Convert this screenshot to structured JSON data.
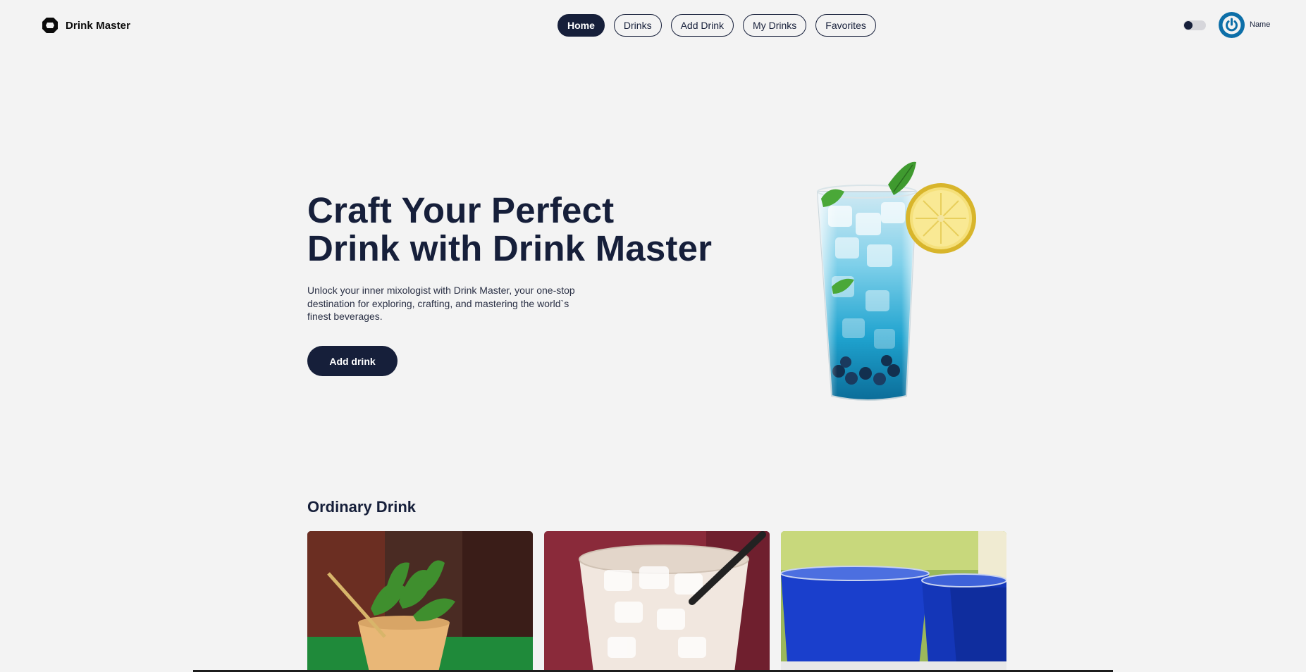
{
  "header": {
    "app_name": "Drink Master",
    "logo_icon": "octagon-logo-icon",
    "nav": [
      {
        "label": "Home",
        "active": true
      },
      {
        "label": "Drinks",
        "active": false
      },
      {
        "label": "Add Drink",
        "active": false
      },
      {
        "label": "My Drinks",
        "active": false
      },
      {
        "label": "Favorites",
        "active": false
      }
    ],
    "theme_toggle": {
      "icon": "theme-toggle-icon"
    },
    "user": {
      "name": "Name",
      "avatar_icon": "power-icon"
    }
  },
  "hero": {
    "title_line1": "Craft Your Perfect",
    "title_line2": "Drink with Drink Master",
    "description": "Unlock your inner mixologist with Drink Master, your one-stop destination for exploring, crafting, and mastering the world`s finest beverages.",
    "cta_label": "Add drink",
    "image_icon": "blue-cocktail-image"
  },
  "section": {
    "title": "Ordinary Drink",
    "cards": [
      {
        "image_icon": "mint-julep-image"
      },
      {
        "image_icon": "white-russian-image"
      },
      {
        "image_icon": "blue-drinks-image"
      }
    ]
  },
  "colors": {
    "primary": "#161f3a",
    "background": "#f3f3f3",
    "avatar": "#0d6fa8"
  }
}
